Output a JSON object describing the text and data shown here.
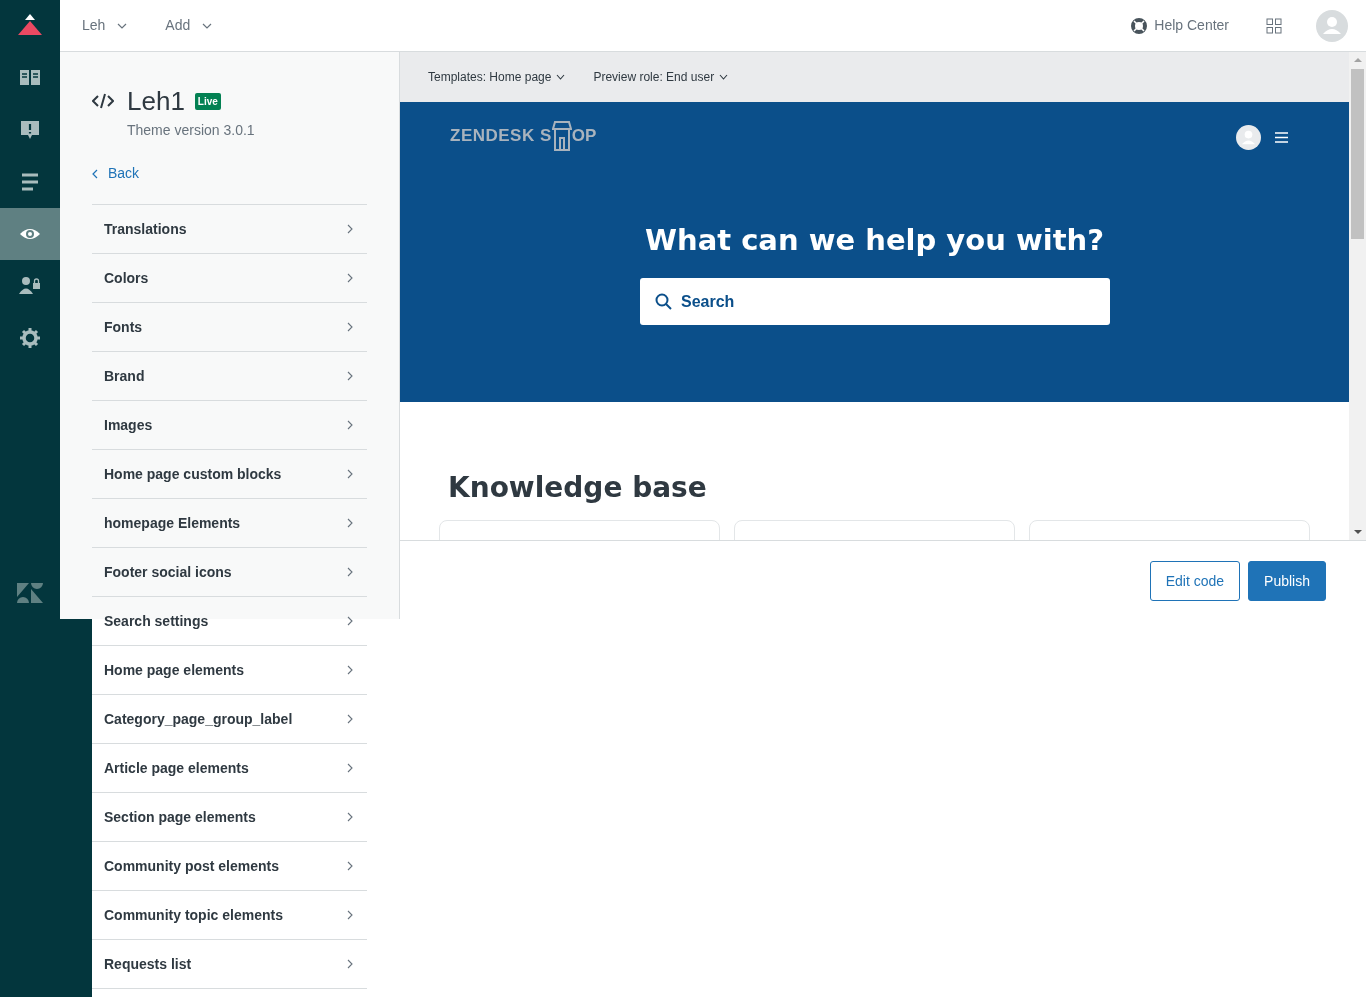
{
  "top_bar": {
    "menus": [
      {
        "label": "Leh"
      },
      {
        "label": "Add"
      }
    ],
    "help_center": "Help Center"
  },
  "nav": [
    {
      "kind": "book",
      "selected": false
    },
    {
      "kind": "alert",
      "selected": false
    },
    {
      "kind": "list",
      "selected": false
    },
    {
      "kind": "eye",
      "selected": true
    },
    {
      "kind": "userlock",
      "selected": false
    },
    {
      "kind": "gear",
      "selected": false
    }
  ],
  "theme": {
    "name": "Leh1",
    "badge": "Live",
    "version": "Theme version 3.0.1",
    "back": "Back"
  },
  "settings": [
    {
      "label": "Translations"
    },
    {
      "label": "Colors"
    },
    {
      "label": "Fonts"
    },
    {
      "label": "Brand"
    },
    {
      "label": "Images"
    },
    {
      "label": "Home page custom blocks"
    },
    {
      "label": "homepage Elements"
    },
    {
      "label": "Footer social icons"
    },
    {
      "label": "Search settings"
    },
    {
      "label": "Home page elements"
    },
    {
      "label": "Category_page_group_label"
    },
    {
      "label": "Article page elements"
    },
    {
      "label": "Section page elements"
    },
    {
      "label": "Community post elements"
    },
    {
      "label": "Community topic elements"
    },
    {
      "label": "Requests list"
    }
  ],
  "preview_toolbar": [
    {
      "label": "Templates: Home page"
    },
    {
      "label": "Preview role: End user"
    }
  ],
  "preview": {
    "logo": [
      "ZENDESK S",
      "OP"
    ],
    "hero_title": "What can we help you with?",
    "search_placeholder": "Search",
    "section_title": "Knowledge base"
  },
  "actions": [
    {
      "label": "Edit code",
      "kind": "secondary"
    },
    {
      "label": "Publish",
      "kind": "primary"
    }
  ]
}
